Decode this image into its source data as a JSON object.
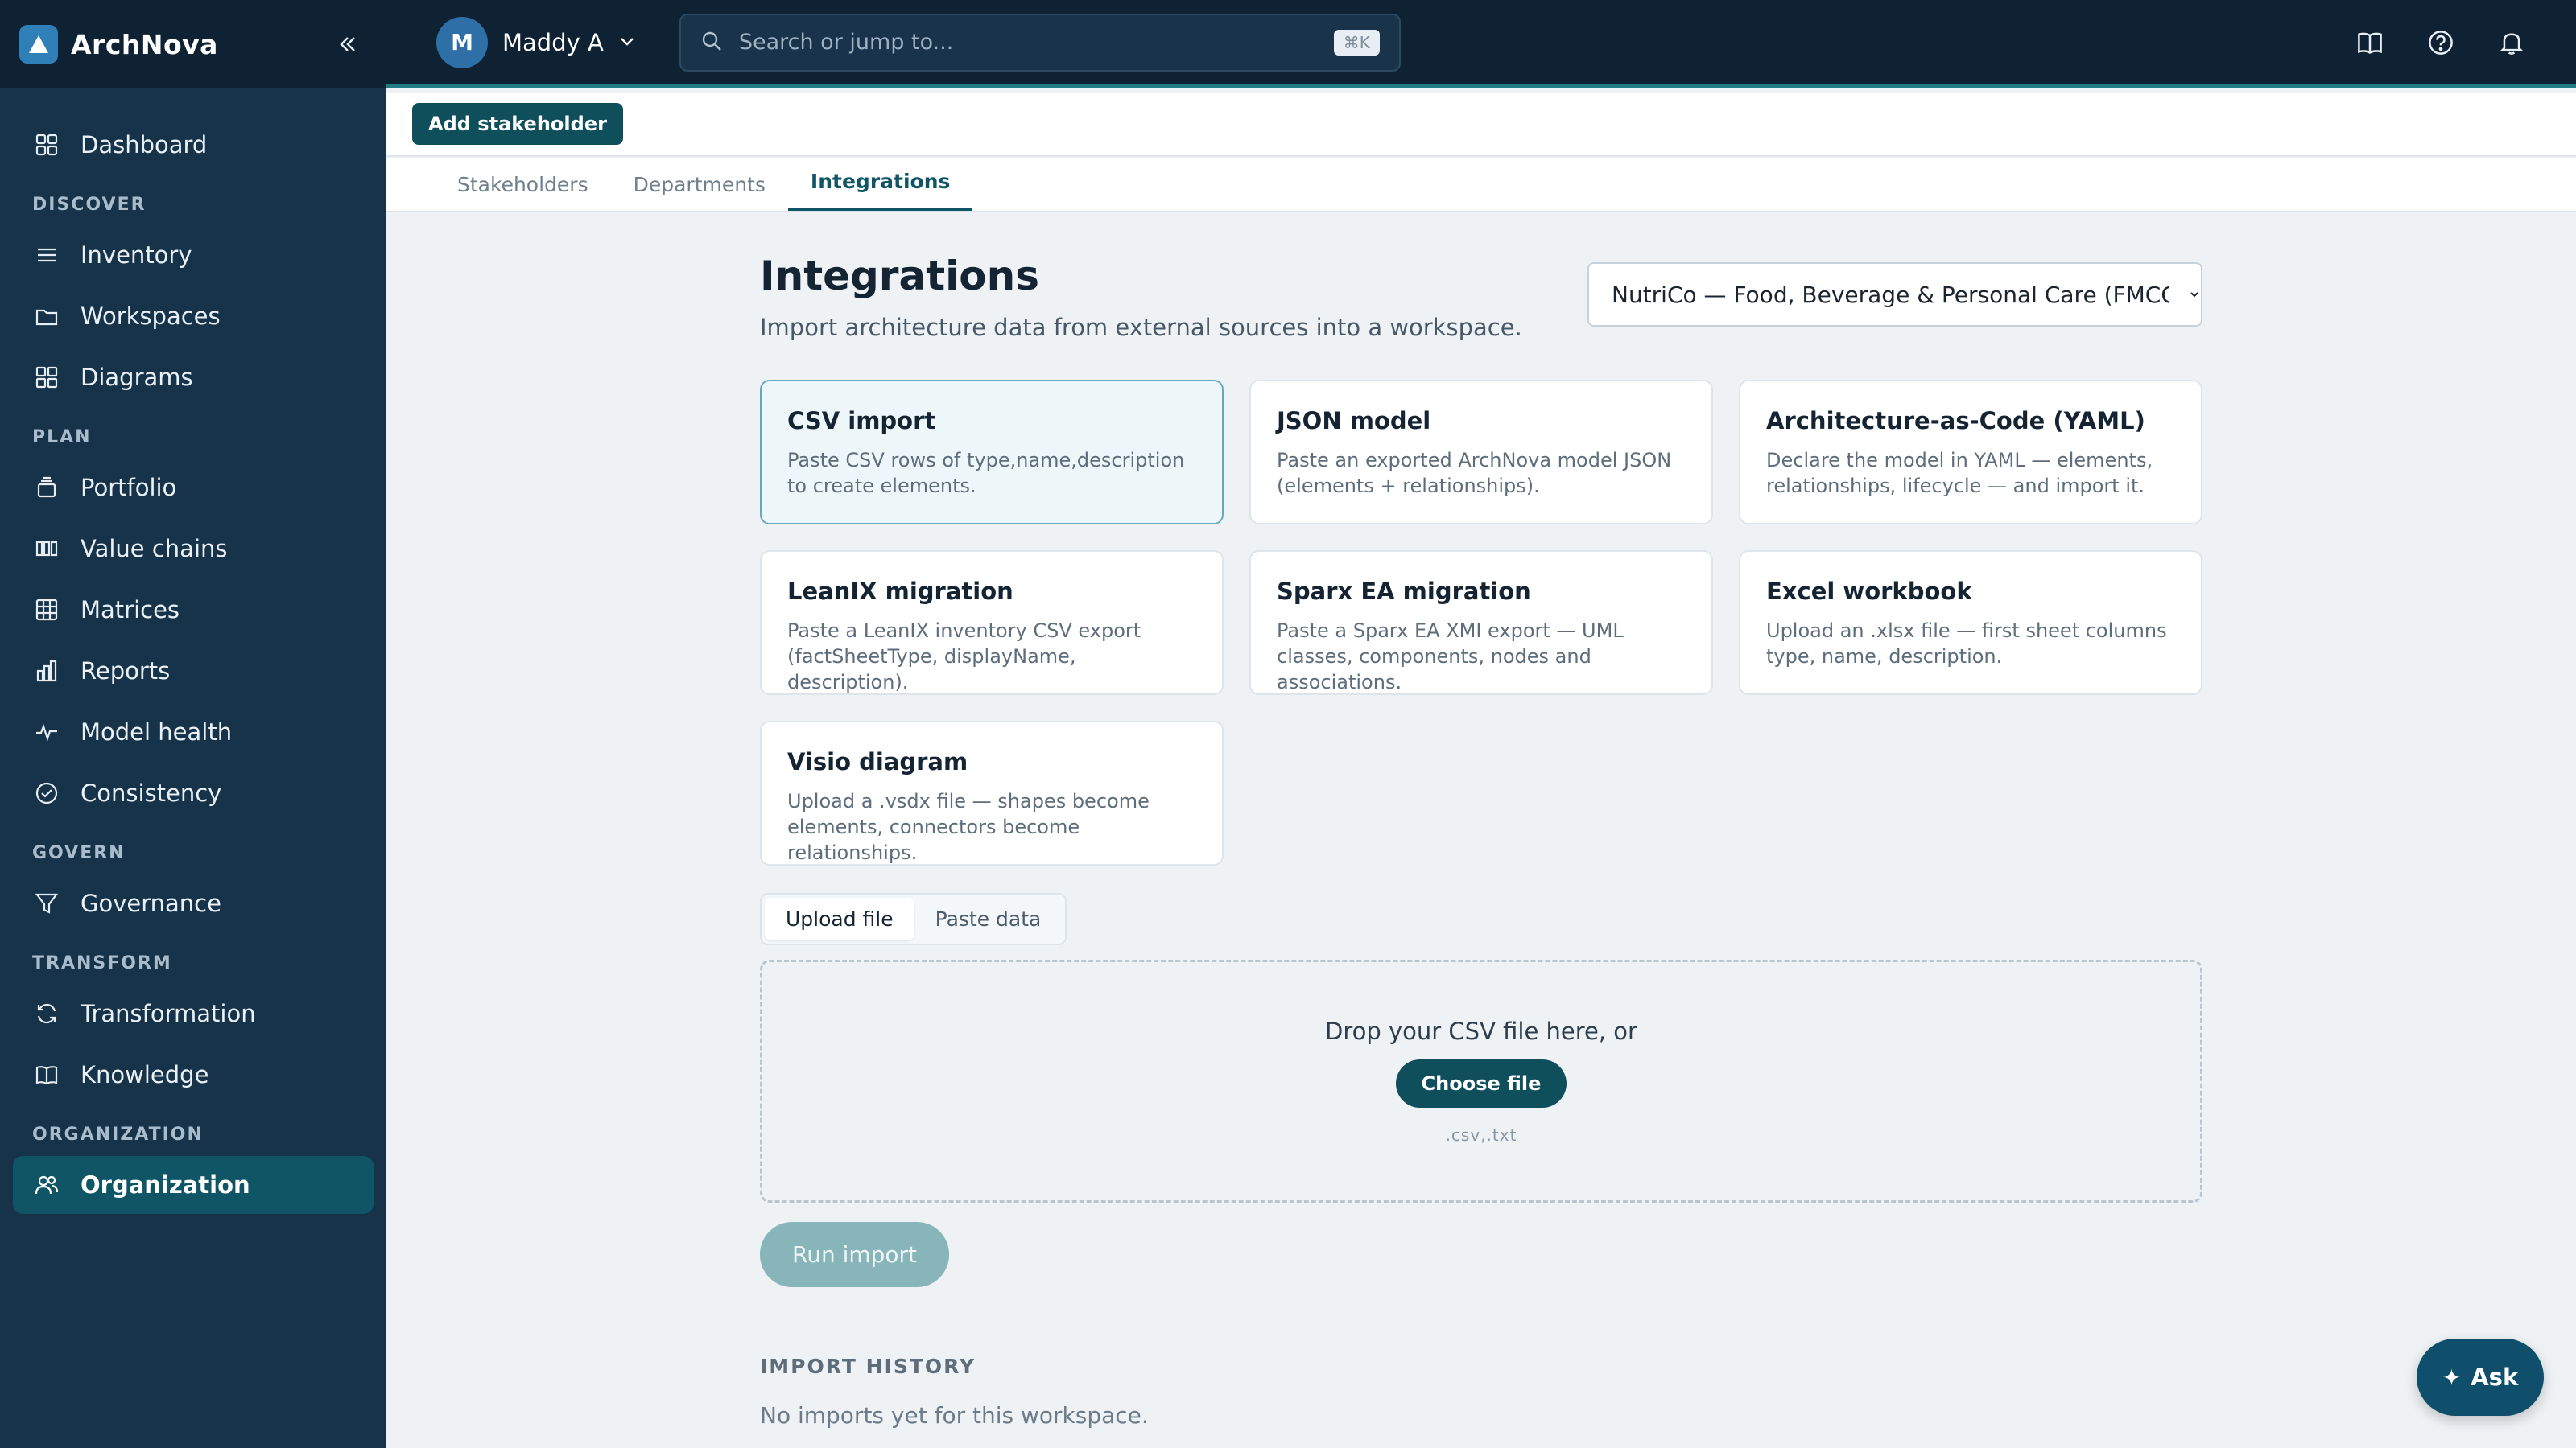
{
  "app": {
    "name": "ArchNova"
  },
  "user": {
    "initial": "M",
    "name": "Maddy A"
  },
  "search": {
    "placeholder": "Search or jump to...",
    "shortcut": "⌘K"
  },
  "sidebar": {
    "dashboard": "Dashboard",
    "sections": {
      "discover": "DISCOVER",
      "plan": "PLAN",
      "govern": "GOVERN",
      "transform": "TRANSFORM",
      "organization": "ORGANIZATION"
    },
    "items": {
      "inventory": "Inventory",
      "workspaces": "Workspaces",
      "diagrams": "Diagrams",
      "portfolio": "Portfolio",
      "value_chains": "Value chains",
      "matrices": "Matrices",
      "reports": "Reports",
      "model_health": "Model health",
      "consistency": "Consistency",
      "governance": "Governance",
      "transformation": "Transformation",
      "knowledge": "Knowledge",
      "organization": "Organization"
    },
    "active": "Organization"
  },
  "actionbar": {
    "add_stakeholder": "Add stakeholder"
  },
  "tabs": [
    "Stakeholders",
    "Departments",
    "Integrations"
  ],
  "active_tab": "Integrations",
  "page": {
    "title": "Integrations",
    "subtitle": "Import architecture data from external sources into a workspace.",
    "workspace_selected": "NutriCo — Food, Beverage & Personal Care (FMCG)"
  },
  "cards": [
    {
      "title": "CSV import",
      "desc": "Paste CSV rows of type,name,description to create elements."
    },
    {
      "title": "JSON model",
      "desc": "Paste an exported ArchNova model JSON (elements + relationships)."
    },
    {
      "title": "Architecture-as-Code (YAML)",
      "desc": "Declare the model in YAML — elements, relationships, lifecycle — and import it."
    },
    {
      "title": "LeanIX migration",
      "desc": "Paste a LeanIX inventory CSV export (factSheetType, displayName, description)."
    },
    {
      "title": "Sparx EA migration",
      "desc": "Paste a Sparx EA XMI export — UML classes, components, nodes and associations."
    },
    {
      "title": "Excel workbook",
      "desc": "Upload an .xlsx file — first sheet columns type, name, description."
    },
    {
      "title": "Visio diagram",
      "desc": "Upload a .vsdx file — shapes become elements, connectors become relationships."
    }
  ],
  "selected_card": "CSV import",
  "mode": {
    "upload": "Upload file",
    "paste": "Paste data",
    "active": "Upload file"
  },
  "dropzone": {
    "text": "Drop your CSV file here, or",
    "button": "Choose file",
    "types": ".csv,.txt"
  },
  "run_import": "Run import",
  "history": {
    "heading": "IMPORT HISTORY",
    "empty": "No imports yet for this workspace."
  },
  "ask": "Ask",
  "colors": {
    "sidebar": "#16334a",
    "topbar": "#0f2233",
    "accent": "#0f5566",
    "active_nav": "#0f5566"
  }
}
